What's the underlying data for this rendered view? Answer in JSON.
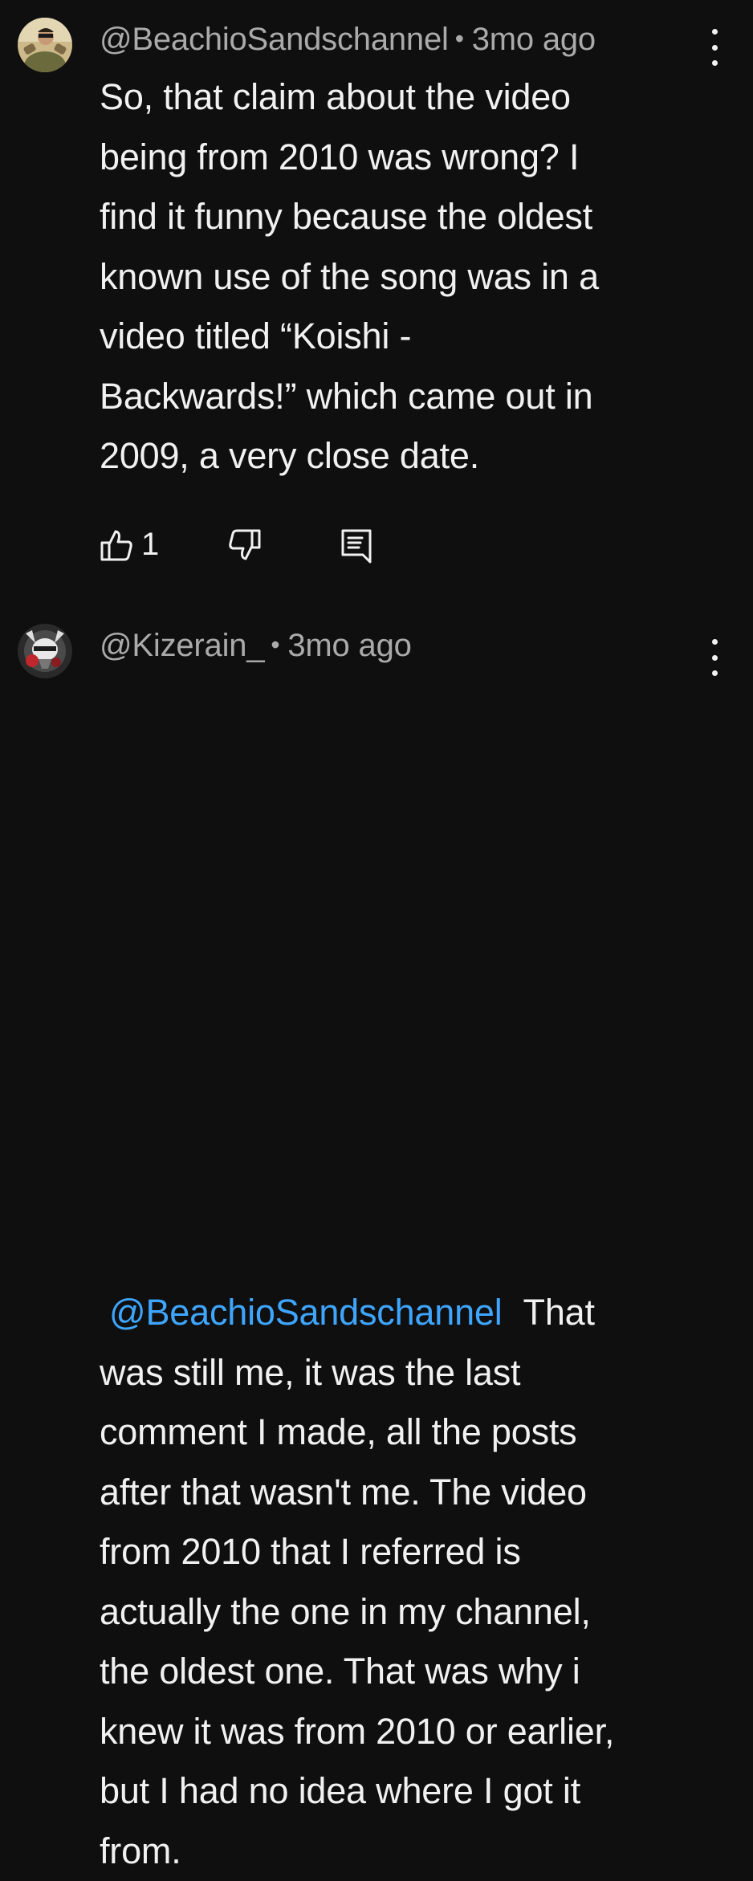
{
  "comments": [
    {
      "author": "@BeachioSandschannel",
      "separator": "•",
      "time": "3mo ago",
      "lines": [
        "So, that claim about the video",
        "being from 2010 was wrong? I",
        "find it funny because the oldest",
        "known use of the song was in a",
        "video titled “Koishi -",
        "Backwards!” which came out in",
        "2009, a very close date."
      ],
      "like_count": "1"
    },
    {
      "author": "@Kizerain_",
      "separator": "•",
      "time": "3mo ago",
      "mention": "@BeachioSandschannel",
      "first_line_rest": "That",
      "lines": [
        "was still me,  it was the last",
        "comment I made, all the posts",
        "after that wasn't me. The video",
        "from 2010 that I referred is",
        "actually the one in my channel,",
        "the oldest one. That was why i",
        "knew it was from 2010 or earlier,",
        "but I had no idea where I got it",
        "from."
      ]
    }
  ],
  "icons": {
    "like": "thumbs-up-icon",
    "dislike": "thumbs-down-icon",
    "reply": "reply-comment-icon",
    "menu": "kebab-menu-icon"
  },
  "colors": {
    "background": "#0f0f0f",
    "text": "#f1f1f1",
    "meta": "#aaaaaa",
    "mention": "#3ea6ff"
  }
}
